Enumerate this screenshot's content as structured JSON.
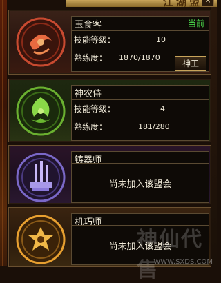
{
  "window": {
    "title": "江湖盟会",
    "close_label": "×"
  },
  "professions": [
    {
      "name": "玉食客",
      "status": "当前",
      "skill_level_label": "技能等级：",
      "skill_level": "10",
      "proficiency_label": "熟练度：",
      "proficiency": "1870/1870",
      "button": "神工",
      "color": "#d04a30"
    },
    {
      "name": "神农侍",
      "skill_level_label": "技能等级：",
      "skill_level": "4",
      "proficiency_label": "熟练度：",
      "proficiency": "181/280",
      "color": "#7ac840"
    },
    {
      "name": "铸器师",
      "join_text": "尚未加入该盟会",
      "color": "#8a78d8"
    },
    {
      "name": "机巧师",
      "join_text": "尚未加入该盟会",
      "color": "#e8a030"
    }
  ],
  "watermark": {
    "logo": "神仙代售",
    "url": "WWW.SXDS.COM"
  }
}
